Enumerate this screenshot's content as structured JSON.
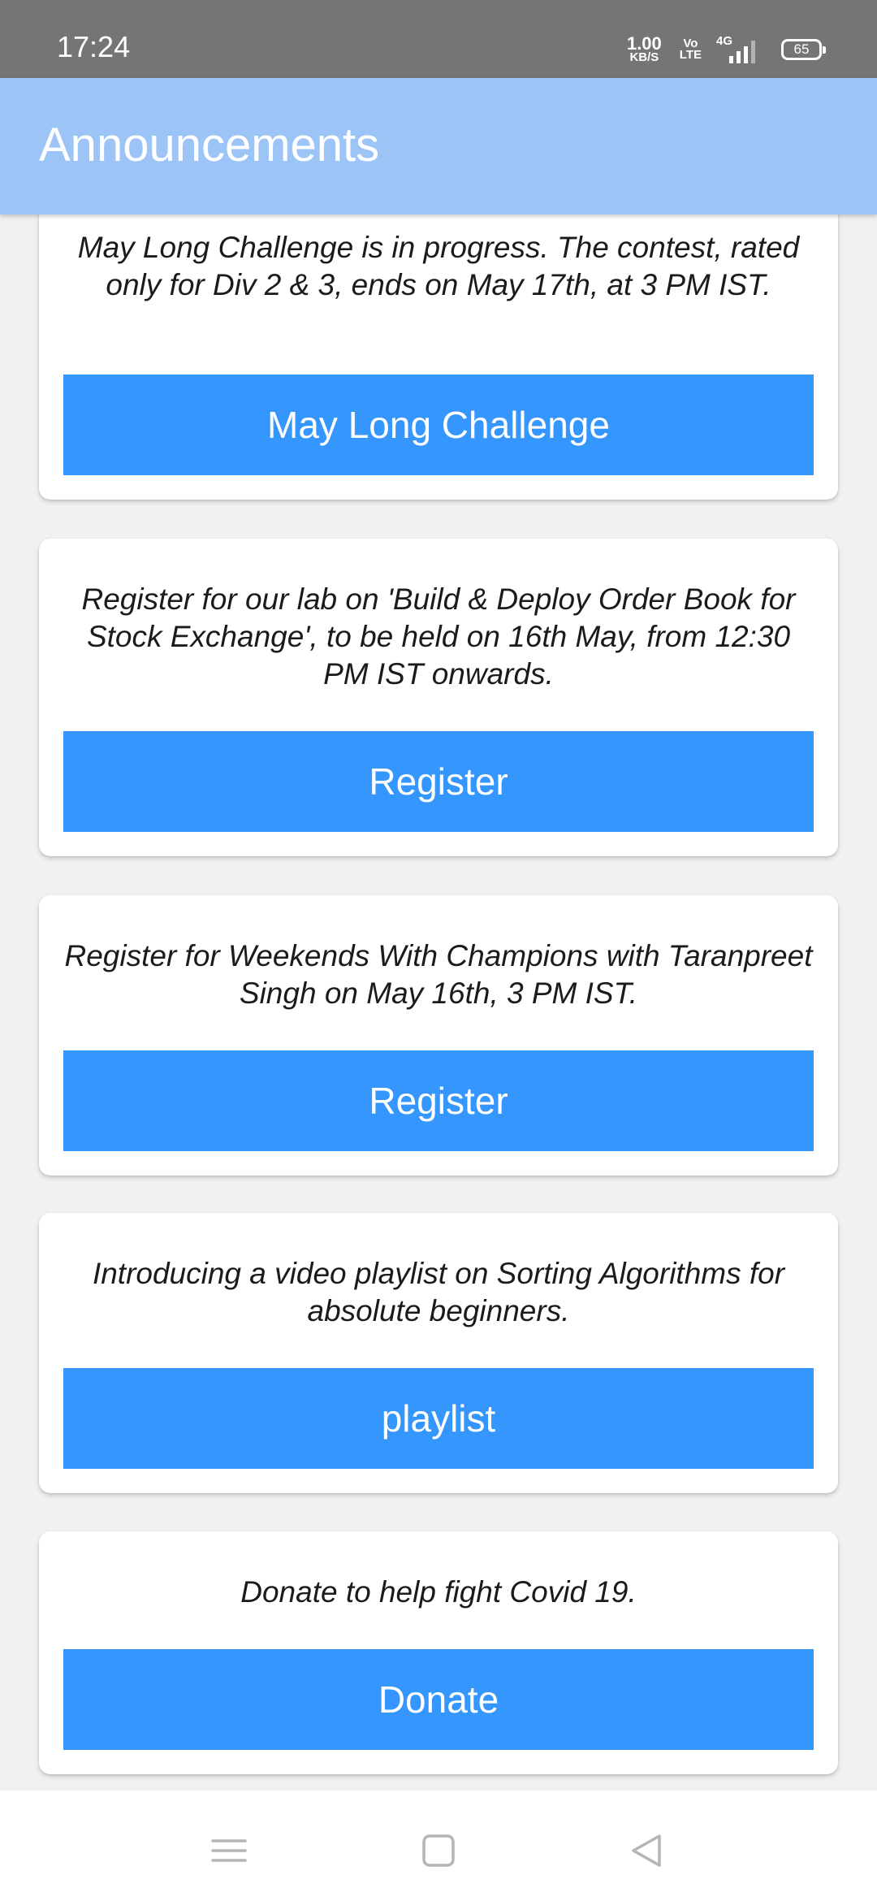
{
  "status_bar": {
    "time": "17:24",
    "net_speed_value": "1.00",
    "net_speed_unit": "KB/S",
    "volte_top": "Vo",
    "volte_bottom": "LTE",
    "network_type": "4G",
    "battery_level": "65",
    "signal_bars": 4
  },
  "app_bar": {
    "title": "Announcements",
    "background_color": "#9cc4f7"
  },
  "announcements": [
    {
      "text": "May Long Challenge is in progress. The contest, rated only for Div 2 & 3, ends on May 17th, at 3 PM IST.",
      "button_label": "May Long Challenge"
    },
    {
      "text": "Register for our lab on 'Build & Deploy Order Book for Stock Exchange', to be held on 16th May, from 12:30 PM IST onwards.",
      "button_label": "Register"
    },
    {
      "text": "Register for Weekends With Champions with Taranpreet Singh on May 16th, 3 PM IST.",
      "button_label": "Register"
    },
    {
      "text": "Introducing a video playlist on Sorting Algorithms for absolute beginners.",
      "button_label": "playlist"
    },
    {
      "text": "Donate to help fight Covid 19.",
      "button_label": "Donate"
    }
  ],
  "colors": {
    "button": "#3596fd",
    "page_background": "#f1f1f1",
    "status_bar": "#757575"
  },
  "nav_bar": {
    "icons": [
      "menu-icon",
      "home-square-icon",
      "back-triangle-icon"
    ]
  }
}
